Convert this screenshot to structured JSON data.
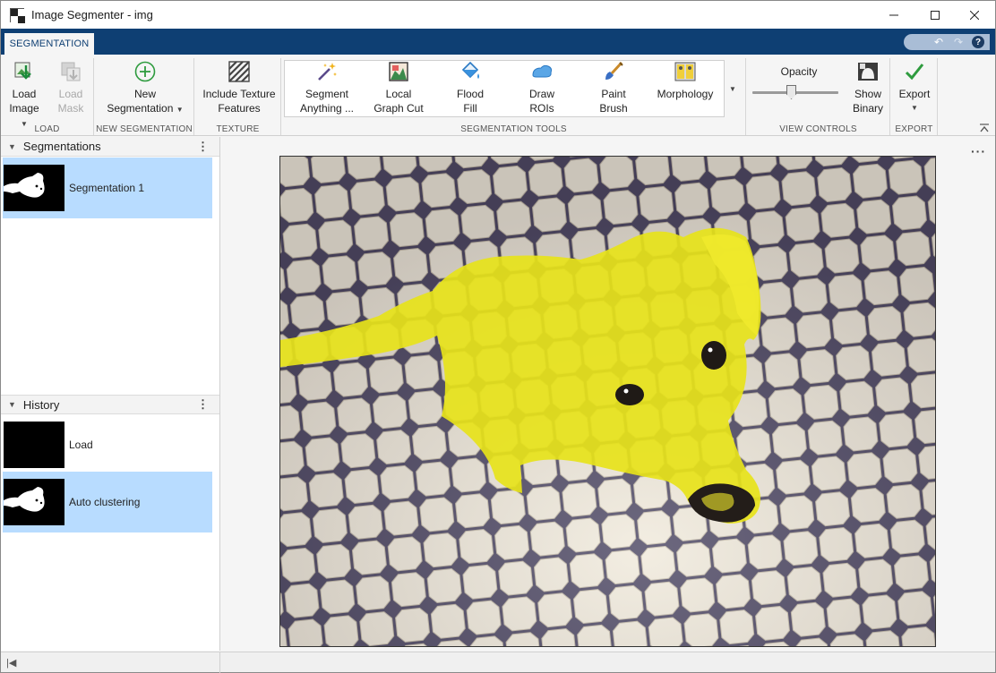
{
  "window": {
    "title": "Image Segmenter - img"
  },
  "tabs": [
    {
      "label": "SEGMENTATION"
    }
  ],
  "toolstrip": {
    "load": {
      "title": "LOAD",
      "load_image": [
        "Load",
        "Image"
      ],
      "load_mask": [
        "Load",
        "Mask"
      ]
    },
    "new_segmentation": {
      "title": "NEW SEGMENTATION",
      "button": [
        "New",
        "Segmentation"
      ]
    },
    "texture": {
      "title": "TEXTURE",
      "button": [
        "Include Texture",
        "Features"
      ]
    },
    "segmentation_tools": {
      "title": "SEGMENTATION TOOLS",
      "tools": [
        {
          "label": [
            "Segment",
            "Anything ..."
          ],
          "icon": "magic-wand-icon"
        },
        {
          "label": [
            "Local",
            "Graph Cut"
          ],
          "icon": "graph-cut-icon"
        },
        {
          "label": [
            "Flood",
            "Fill"
          ],
          "icon": "paint-bucket-icon"
        },
        {
          "label": [
            "Draw",
            "ROIs"
          ],
          "icon": "roi-icon"
        },
        {
          "label": [
            "Paint",
            "Brush"
          ],
          "icon": "paint-brush-icon"
        },
        {
          "label": [
            "Morphology",
            ""
          ],
          "icon": "morphology-icon"
        }
      ]
    },
    "view_controls": {
      "title": "VIEW CONTROLS",
      "opacity_label": "Opacity",
      "opacity_value": 0.45,
      "show_binary": [
        "Show",
        "Binary"
      ]
    },
    "export": {
      "title": "EXPORT",
      "button": "Export"
    }
  },
  "segmentations_panel": {
    "title": "Segmentations",
    "items": [
      {
        "label": "Segmentation 1",
        "selected": true
      }
    ]
  },
  "history_panel": {
    "title": "History",
    "items": [
      {
        "label": "Load",
        "selected": false
      },
      {
        "label": "Auto clustering",
        "selected": true
      }
    ]
  },
  "colors": {
    "tab_bar": "#0e3f73",
    "selection": "#b8dcff",
    "overlay": "#e8e41a"
  }
}
